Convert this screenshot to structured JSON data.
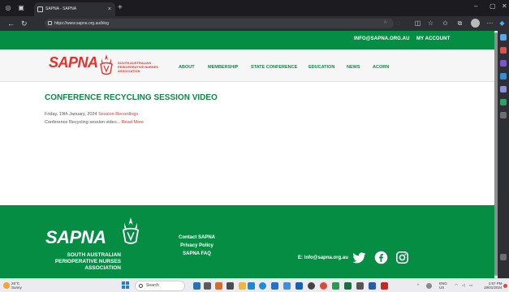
{
  "browser": {
    "tab_title": "SAPNA - SAPNA",
    "tab_close": "×",
    "new_tab": "+",
    "url": "https://www.sapna.org.au/blog",
    "minimize": "–",
    "close": "✕"
  },
  "site": {
    "top_links": [
      "INFO@SAPNA.ORG.AU",
      "MY ACCOUNT"
    ],
    "logo_text": "SAPNA",
    "logo_sub": "SOUTH AUSTRALIAN PERIOPERATIVE NURSES ASSOCIATION",
    "menu": [
      "ABOUT",
      "MEMBERSHIP",
      "STATE CONFERENCE",
      "EDUCATION",
      "NEWS",
      "ACORN"
    ],
    "accent": "#058d44",
    "brand_red": "#e2322b"
  },
  "post": {
    "title": "CONFERENCE RECYCLING SESSION VIDEO",
    "date": "Friday, 19th January, 2024",
    "category": "Session Recordings",
    "excerpt": "Conference Recycling session video...",
    "read_more": "Read More"
  },
  "footer": {
    "logo_text": "SAPNA",
    "logo_sub_lines": [
      "SOUTH AUSTRALIAN",
      "PERIOPERATIVE NURSES",
      "ASSOCIATION"
    ],
    "links": [
      "Contact SAPNA",
      "Privacy Policy",
      "SAPNA FAQ"
    ],
    "email": "E: info@sapna.org.au",
    "social": [
      "twitter-icon",
      "facebook-icon",
      "instagram-icon"
    ]
  },
  "taskbar": {
    "weather_temp": "25°C",
    "weather_desc": "Sunny",
    "search": "Search",
    "lang_top": "ENG",
    "lang_bottom": "US",
    "time": "1:57 PM",
    "date": "19/01/2024"
  }
}
